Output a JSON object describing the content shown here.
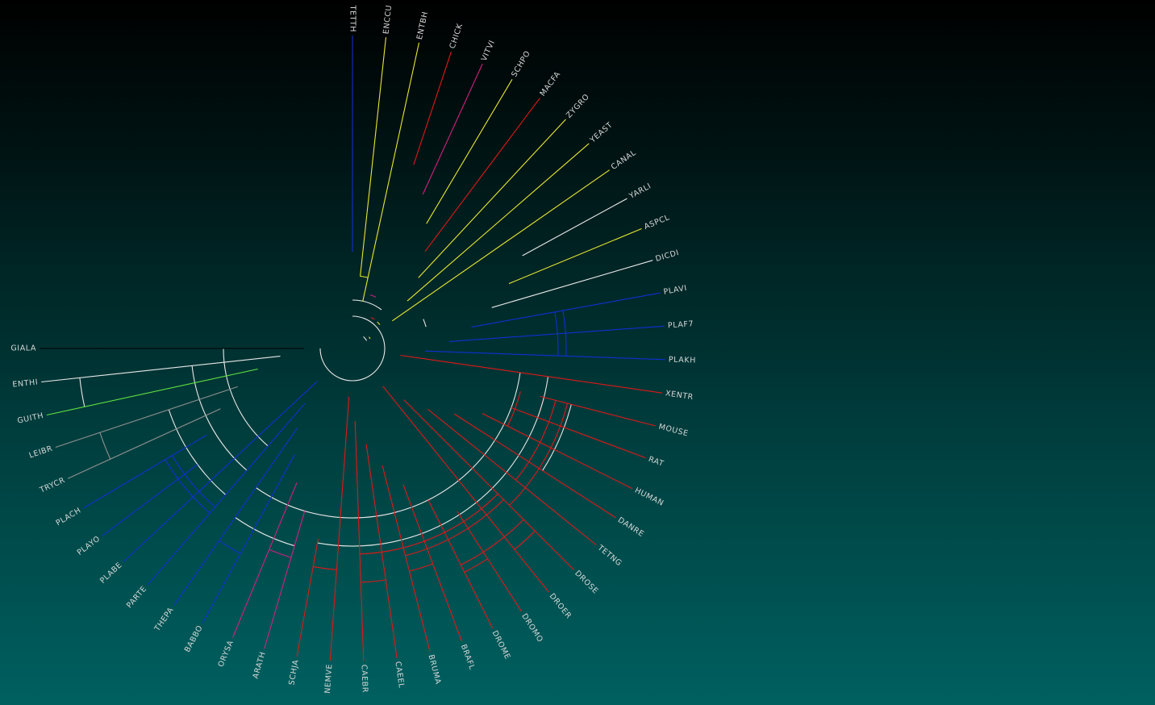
{
  "tree": {
    "colors": {
      "white": "#e8e8e8",
      "blue": "#1030d0",
      "red": "#e01818",
      "yellow": "#e8e830",
      "magenta": "#d02080",
      "green": "#60e040",
      "grey": "#909090",
      "black": "#000000"
    },
    "leaves": [
      {
        "label": "GIALA",
        "color": "black"
      },
      {
        "label": "ENTHI",
        "color": "white"
      },
      {
        "label": "GUITH",
        "color": "green"
      },
      {
        "label": "LEIBR",
        "color": "grey"
      },
      {
        "label": "TRYCR",
        "color": "grey"
      },
      {
        "label": "PLACH",
        "color": "blue"
      },
      {
        "label": "PLAYO",
        "color": "blue"
      },
      {
        "label": "PLABE",
        "color": "blue"
      },
      {
        "label": "PARTE",
        "color": "blue"
      },
      {
        "label": "THEPA",
        "color": "blue"
      },
      {
        "label": "BABBO",
        "color": "blue"
      },
      {
        "label": "ORYSA",
        "color": "magenta"
      },
      {
        "label": "ARATH",
        "color": "magenta"
      },
      {
        "label": "SCHJA",
        "color": "red"
      },
      {
        "label": "NEMVE",
        "color": "red"
      },
      {
        "label": "CAEBR",
        "color": "red"
      },
      {
        "label": "CAEEL",
        "color": "red"
      },
      {
        "label": "BRUMA",
        "color": "red"
      },
      {
        "label": "BRAFL",
        "color": "red"
      },
      {
        "label": "DROME",
        "color": "red"
      },
      {
        "label": "DROMO",
        "color": "red"
      },
      {
        "label": "DROER",
        "color": "red"
      },
      {
        "label": "DROSE",
        "color": "red"
      },
      {
        "label": "TETNG",
        "color": "red"
      },
      {
        "label": "DANRE",
        "color": "red"
      },
      {
        "label": "HUMAN",
        "color": "red"
      },
      {
        "label": "RAT",
        "color": "red"
      },
      {
        "label": "MOUSE",
        "color": "red"
      },
      {
        "label": "XENTR",
        "color": "red"
      },
      {
        "label": "PLAKH",
        "color": "blue"
      },
      {
        "label": "PLAF7",
        "color": "blue"
      },
      {
        "label": "PLAVI",
        "color": "blue"
      },
      {
        "label": "DICDI",
        "color": "white"
      },
      {
        "label": "ASPCL",
        "color": "yellow"
      },
      {
        "label": "YARLI",
        "color": "white"
      },
      {
        "label": "CANAL",
        "color": "yellow"
      },
      {
        "label": "YEAST",
        "color": "yellow"
      },
      {
        "label": "ZYGRO",
        "color": "yellow"
      },
      {
        "label": "MACFA",
        "color": "red"
      },
      {
        "label": "SCHPO",
        "color": "yellow"
      },
      {
        "label": "VITVI",
        "color": "magenta"
      },
      {
        "label": "CHICK",
        "color": "red"
      },
      {
        "label": "ENTBH",
        "color": "yellow"
      },
      {
        "label": "ENCCU",
        "color": "yellow"
      },
      {
        "label": "TETTH",
        "color": "blue"
      }
    ]
  }
}
